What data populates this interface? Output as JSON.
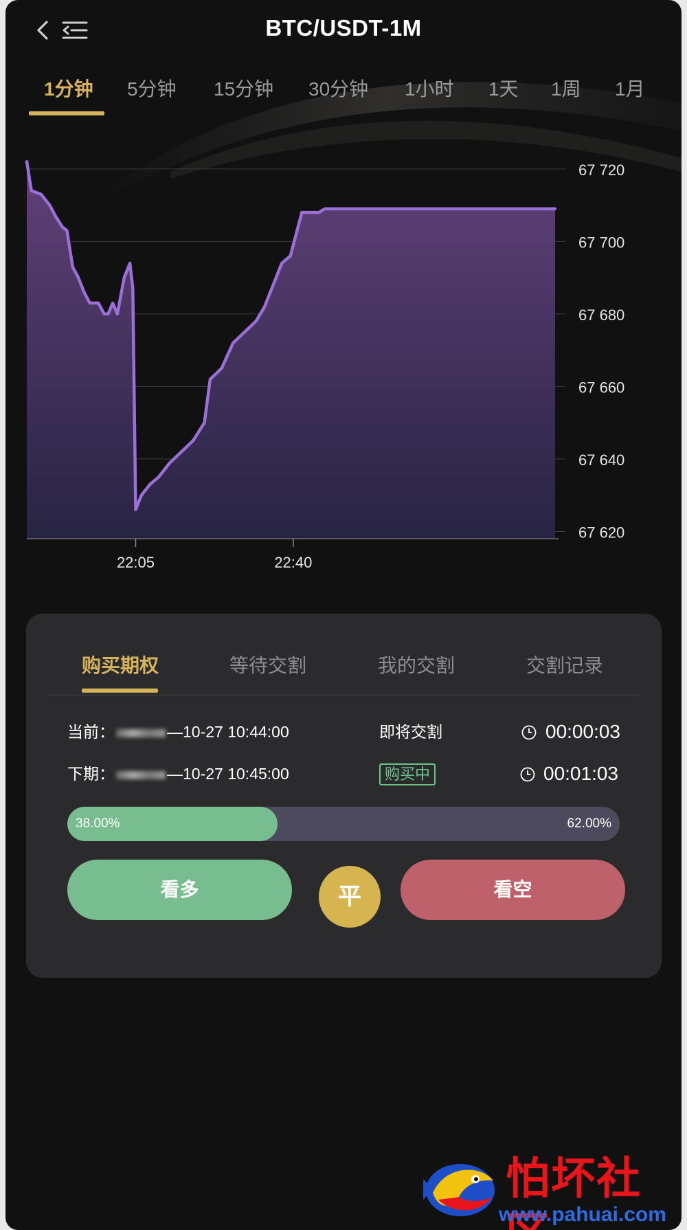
{
  "header": {
    "title": "BTC/USDT-1M"
  },
  "intervals": [
    {
      "label": "1分钟",
      "active": true
    },
    {
      "label": "5分钟"
    },
    {
      "label": "15分钟"
    },
    {
      "label": "30分钟"
    },
    {
      "label": "1小时"
    },
    {
      "label": "1天"
    },
    {
      "label": "1周"
    },
    {
      "label": "1月"
    }
  ],
  "chart_data": {
    "type": "area",
    "x_ticks": [
      "22:05",
      "22:40"
    ],
    "y_ticks": [
      "67 720",
      "67 700",
      "67 680",
      "67 660",
      "67 640",
      "67 620"
    ],
    "ylim": [
      67618,
      67723
    ],
    "grid": true,
    "series": [
      {
        "points": [
          [
            0,
            67722
          ],
          [
            0.8,
            67714
          ],
          [
            2.5,
            67713
          ],
          [
            4,
            67710
          ],
          [
            5,
            67707
          ],
          [
            6.2,
            67704
          ],
          [
            7,
            67703
          ],
          [
            8,
            67693
          ],
          [
            9,
            67690
          ],
          [
            10,
            67686
          ],
          [
            11,
            67683
          ],
          [
            12.5,
            67683
          ],
          [
            13.5,
            67680
          ],
          [
            14.2,
            67680
          ],
          [
            15,
            67683
          ],
          [
            15.8,
            67680
          ],
          [
            17,
            67690
          ],
          [
            18,
            67694
          ],
          [
            18.5,
            67687
          ],
          [
            19,
            67626
          ],
          [
            20,
            67630
          ],
          [
            21.5,
            67633
          ],
          [
            23,
            67635
          ],
          [
            25,
            67639
          ],
          [
            27,
            67642
          ],
          [
            29,
            67645
          ],
          [
            31,
            67650
          ],
          [
            32,
            67662
          ],
          [
            34,
            67665
          ],
          [
            36,
            67672
          ],
          [
            38,
            67675
          ],
          [
            40,
            67678
          ],
          [
            41.5,
            67682
          ],
          [
            43,
            67688
          ],
          [
            44.5,
            67694
          ],
          [
            46,
            67696
          ],
          [
            47,
            67702
          ],
          [
            48,
            67708
          ],
          [
            51,
            67708
          ],
          [
            52,
            67709
          ],
          [
            93,
            67709
          ]
        ]
      }
    ],
    "colors": {
      "line": "#9a6fd6",
      "fill_top": "#66447f",
      "fill_bottom": "#2a2648"
    }
  },
  "panel": {
    "tabs": [
      {
        "label": "购买期权",
        "active": true
      },
      {
        "label": "等待交割"
      },
      {
        "label": "我的交割"
      },
      {
        "label": "交割记录"
      }
    ],
    "rows": [
      {
        "label": "当前：",
        "time": "—10-27 10:44:00",
        "status": "即将交割",
        "countdown": "00:00:03"
      },
      {
        "label": "下期：",
        "time": "—10-27 10:45:00",
        "status": "购买中",
        "countdown": "00:01:03"
      }
    ],
    "ratio": {
      "left": "38.00%",
      "right": "62.00%",
      "left_fraction": 0.38
    },
    "buttons": {
      "long": "看多",
      "flat": "平",
      "short": "看空"
    }
  },
  "watermark": {
    "text": "怕坏社区",
    "url": "www.pahuai.com"
  }
}
